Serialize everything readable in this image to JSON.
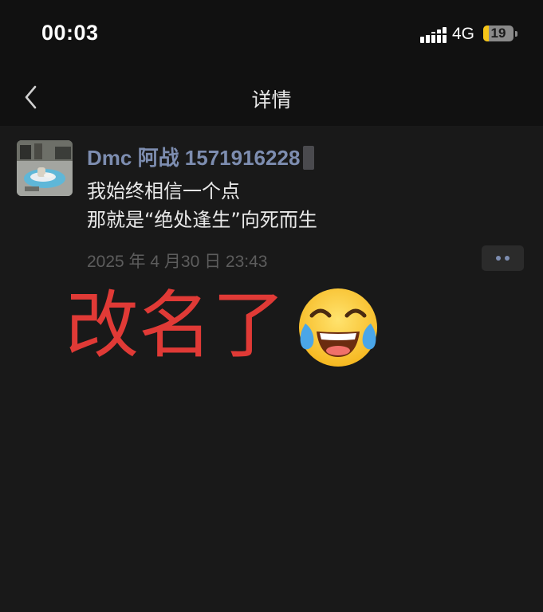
{
  "status_bar": {
    "time": "00:03",
    "network": "4G",
    "battery_level": "19",
    "battery_fraction": 0.19
  },
  "nav": {
    "title": "详情",
    "back_icon": "chevron-left-icon"
  },
  "post": {
    "author": "Dmc 阿战 1571916228",
    "lines": [
      "我始终相信一个点",
      "那就是“绝处逢生”向死而生"
    ],
    "timestamp": "2025 年 4 月30 日 23:43",
    "more_icon": "more-dots-icon"
  },
  "overlay": {
    "text": "改名了",
    "emoji": "tears-of-joy-emoji"
  },
  "colors": {
    "background": "#191919",
    "bar": "#111111",
    "author": "#7d8db0",
    "overlay_text": "#e03a36",
    "battery": "#f5c518"
  }
}
